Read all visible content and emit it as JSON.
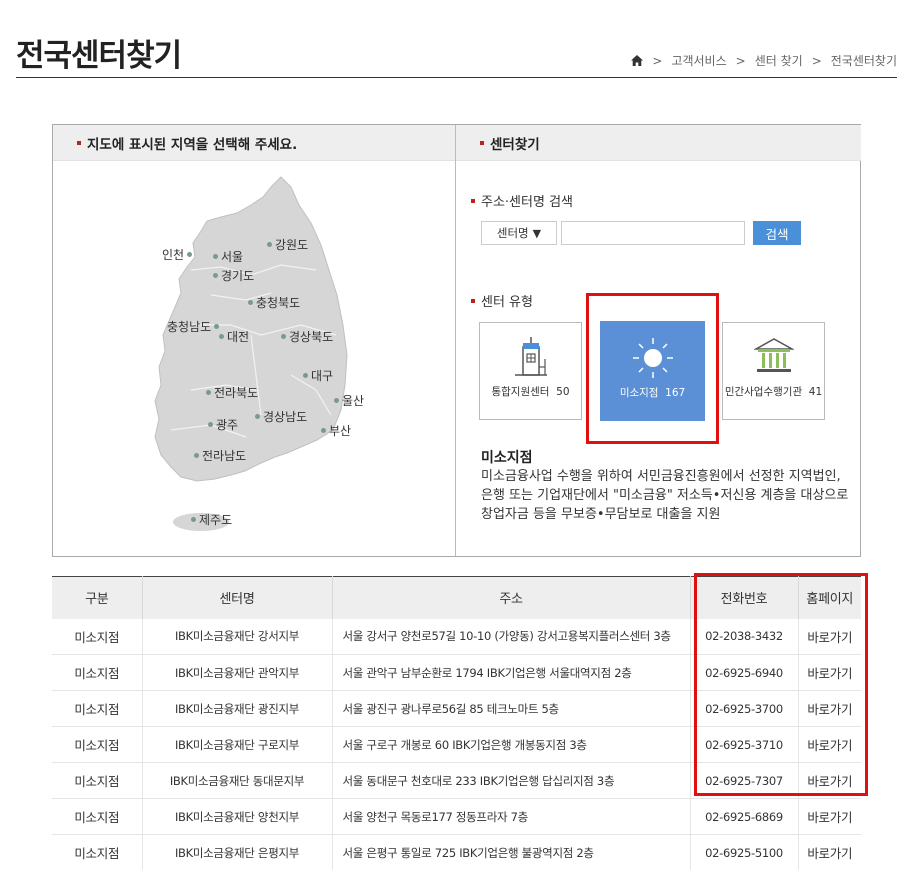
{
  "page": {
    "title": "전국센터찾기",
    "breadcrumb": [
      "고객서비스",
      "센터 찾기",
      "전국센터찾기"
    ],
    "breadcrumb_sep": ">"
  },
  "map_panel": {
    "heading": "지도에 표시된 지역을 선택해 주세요.",
    "regions": [
      "인천",
      "서울",
      "강원도",
      "경기도",
      "충청북도",
      "충청남도",
      "대전",
      "경상북도",
      "대구",
      "전라북도",
      "울산",
      "경상남도",
      "광주",
      "부산",
      "전라남도",
      "제주도"
    ]
  },
  "finder_panel": {
    "heading": "센터찾기",
    "search_label": "주소·센터명 검색",
    "select_value": "센터명",
    "select_arrow": "▼",
    "search_button": "검색",
    "type_label": "센터 유형",
    "types": [
      {
        "name": "통합지원센터",
        "count": "50",
        "icon": "building-icon"
      },
      {
        "name": "미소지점",
        "count": "167",
        "icon": "sun-icon"
      },
      {
        "name": "민간사업수행기관",
        "count": "41",
        "icon": "institution-icon"
      }
    ],
    "desc_title": "미소지점",
    "desc_body": "미소금융사업 수행을 위하여 서민금융진흥원에서 선정한 지역법인, 은행 또는 기업재단에서 \"미소금융\" 저소득•저신용 계층을 대상으로 창업자금 등을 무보증•무담보로 대출을 지원"
  },
  "table": {
    "headers": [
      "구분",
      "센터명",
      "주소",
      "전화번호",
      "홈페이지"
    ],
    "rows": [
      [
        "미소지점",
        "IBK미소금융재단 강서지부",
        "서울 강서구 양천로57길 10-10 (가양동) 강서고용복지플러스센터 3층",
        "02-2038-3432",
        "바로가기"
      ],
      [
        "미소지점",
        "IBK미소금융재단 관악지부",
        "서울 관악구 남부순환로 1794 IBK기업은행 서울대역지점 2층",
        "02-6925-6940",
        "바로가기"
      ],
      [
        "미소지점",
        "IBK미소금융재단 광진지부",
        "서울 광진구 광나루로56길 85 테크노마트 5층",
        "02-6925-3700",
        "바로가기"
      ],
      [
        "미소지점",
        "IBK미소금융재단 구로지부",
        "서울 구로구 개봉로 60 IBK기업은행 개봉동지점 3층",
        "02-6925-3710",
        "바로가기"
      ],
      [
        "미소지점",
        "IBK미소금융재단 동대문지부",
        "서울 동대문구 천호대로 233 IBK기업은행 답십리지점 3층",
        "02-6925-7307",
        "바로가기"
      ],
      [
        "미소지점",
        "IBK미소금융재단 양천지부",
        "서울 양천구 목동로177 정동프라자 7층",
        "02-6925-6869",
        "바로가기"
      ],
      [
        "미소지점",
        "IBK미소금융재단 은평지부",
        "서울 은평구 통일로 725 IBK기업은행 불광역지점 2층",
        "02-6925-5100",
        "바로가기"
      ]
    ]
  },
  "colors": {
    "accent": "#5b8fd6",
    "search_button": "#4a90d9",
    "highlight": "#e01010",
    "bullet": "#b22222"
  }
}
